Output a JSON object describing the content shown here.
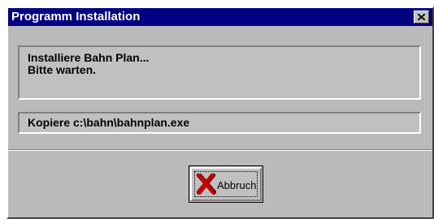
{
  "window": {
    "title": "Programm Installation",
    "close_icon": "close-icon"
  },
  "message": {
    "line1": "Installiere Bahn Plan...",
    "line2": "Bitte warten."
  },
  "status": {
    "copy_text": "Kopiere c:\\bahn\\bahnplan.exe"
  },
  "buttons": {
    "cancel_label": "Abbruch",
    "cancel_icon": "red-x-icon"
  },
  "colors": {
    "titlebar": "#000080",
    "face": "#c0c0c0",
    "cancel_icon": "#cc0000"
  }
}
